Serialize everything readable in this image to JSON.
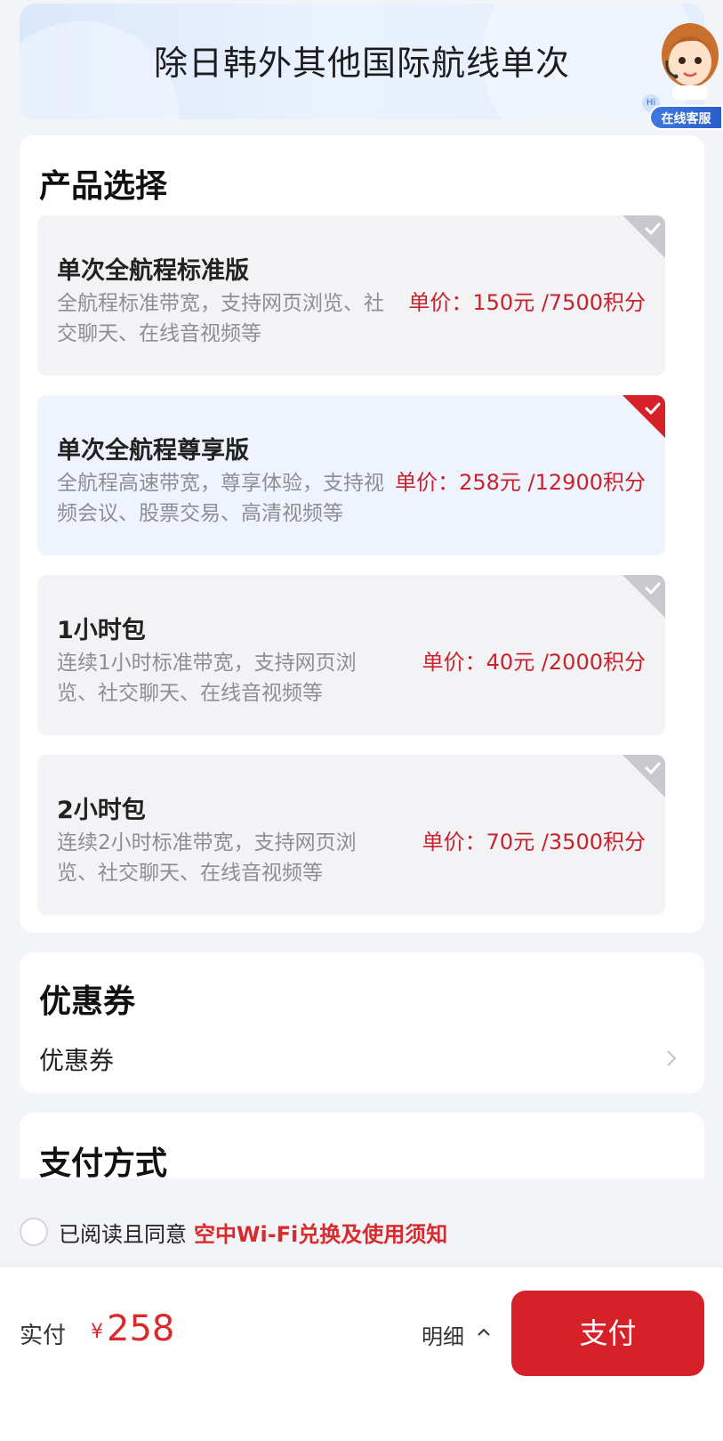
{
  "banner": {
    "title": "除日韩外其他国际航线单次",
    "cs_hi": "Hi",
    "cs_label": "在线客服"
  },
  "products": {
    "title": "产品选择",
    "items": [
      {
        "name": "单次全航程标准版",
        "desc": "全航程标准带宽，支持网页浏览、社交聊天、在线音视频等",
        "price": "单价：150元 /7500积分",
        "selected": false
      },
      {
        "name": "单次全航程尊享版",
        "desc": "全航程高速带宽，尊享体验，支持视频会议、股票交易、高清视频等",
        "price": "单价：258元 /12900积分",
        "selected": true
      },
      {
        "name": "1小时包",
        "desc": "连续1小时标准带宽，支持网页浏览、社交聊天、在线音视频等",
        "price": "单价：40元 /2000积分",
        "selected": false
      },
      {
        "name": "2小时包",
        "desc": "连续2小时标准带宽，支持网页浏览、社交聊天、在线音视频等",
        "price": "单价：70元 /3500积分",
        "selected": false
      }
    ]
  },
  "coupon": {
    "title": "优惠券",
    "row_label": "优惠券"
  },
  "payment": {
    "title": "支付方式"
  },
  "agreement": {
    "text": "已阅读且同意",
    "link": "空中Wi-Fi兑换及使用须知"
  },
  "footer": {
    "pay_label": "实付",
    "currency": "¥",
    "amount": "258",
    "detail_label": "明细",
    "pay_button": "支付"
  },
  "colors": {
    "accent": "#d72129",
    "selected_bg": "#eef3fe",
    "card_bg": "#f3f3f5"
  }
}
